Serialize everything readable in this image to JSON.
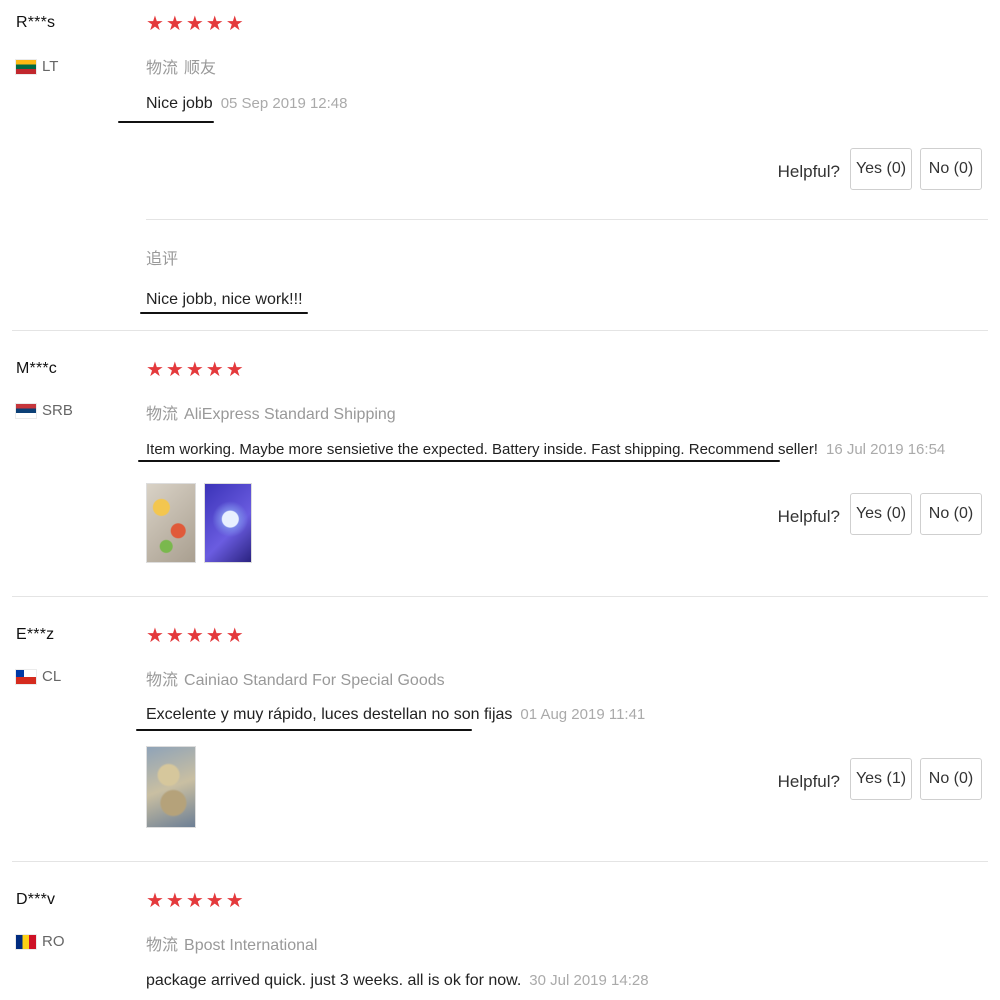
{
  "reviews": [
    {
      "user": "R***s",
      "country": "LT",
      "stars": "★★★★★",
      "shipping_cn": "物流",
      "shipping": "顺友",
      "text": "Nice jobb",
      "date": "05 Sep 2019 12:48",
      "helpful_label": "Helpful?",
      "yes_label": "Yes (0)",
      "no_label": "No (0)",
      "followup_label": "追评",
      "followup_text": "Nice jobb, nice work!!!"
    },
    {
      "user": "M***c",
      "country": "SRB",
      "stars": "★★★★★",
      "shipping_cn": "物流",
      "shipping": "AliExpress Standard Shipping",
      "text": "Item working. Maybe more sensietive the expected. Battery inside. Fast shipping. Recommend seller!",
      "date": "16 Jul 2019 16:54",
      "helpful_label": "Helpful?",
      "yes_label": "Yes (0)",
      "no_label": "No (0)"
    },
    {
      "user": "E***z",
      "country": "CL",
      "stars": "★★★★★",
      "shipping_cn": "物流",
      "shipping": "Cainiao Standard For Special Goods",
      "text": "Excelente y muy rápido, luces destellan no son fijas",
      "date": "01 Aug 2019 11:41",
      "helpful_label": "Helpful?",
      "yes_label": "Yes (1)",
      "no_label": "No (0)"
    },
    {
      "user": "D***v",
      "country": "RO",
      "stars": "★★★★★",
      "shipping_cn": "物流",
      "shipping": "Bpost International",
      "text": "package arrived quick. just 3 weeks. all is ok for now.",
      "date": "30 Jul 2019 14:28"
    }
  ],
  "colors": {
    "star": "#e4393c",
    "muted": "#999999",
    "border": "#cfcfcf"
  }
}
